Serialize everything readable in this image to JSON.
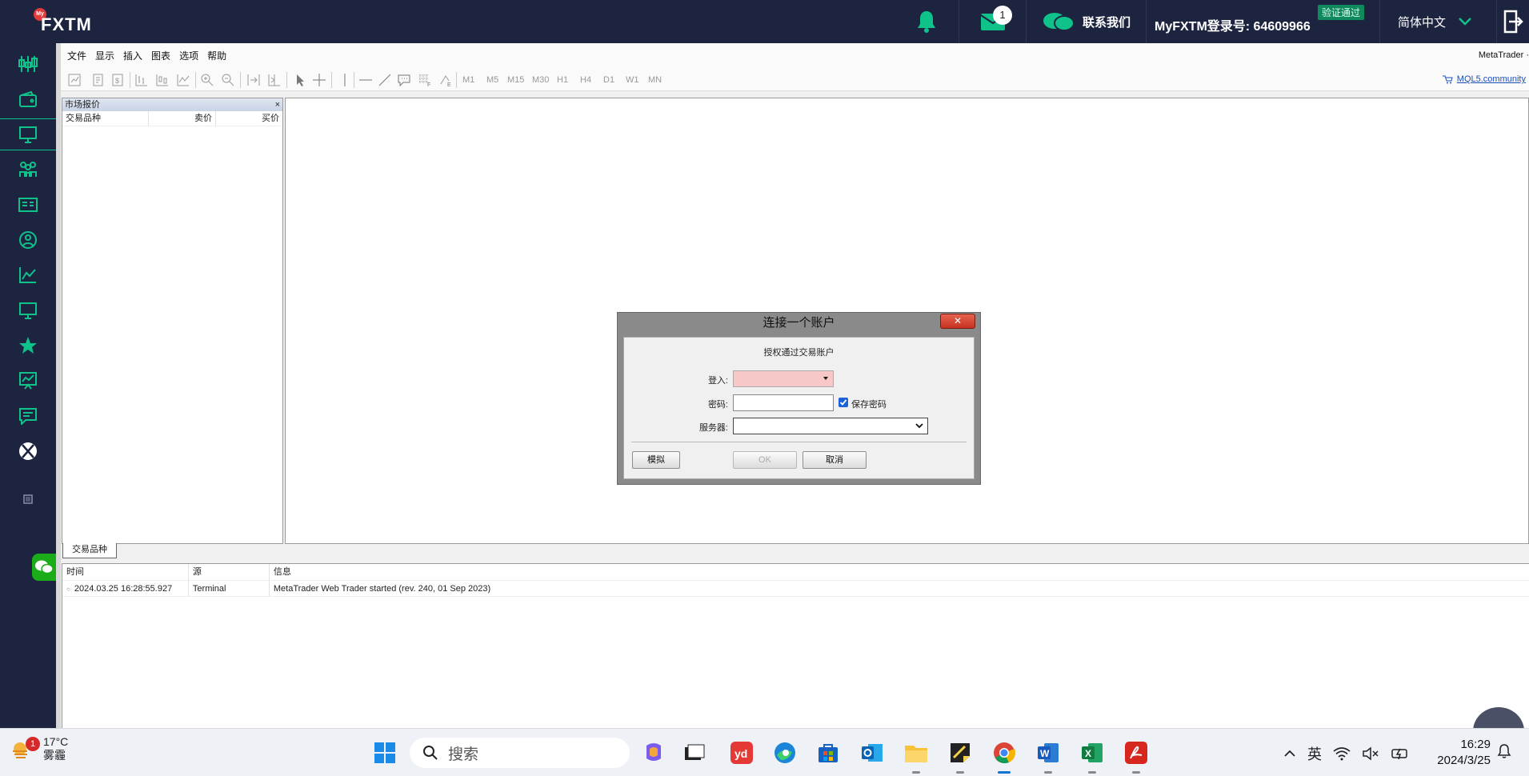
{
  "topbar": {
    "logo_badge": "My",
    "logo_text": "FXTM",
    "mail_count": "1",
    "contact_label": "联系我们",
    "account_label": "MyFXTM登录号: 64609966",
    "verified_label": "验证通过",
    "language": "简体中文"
  },
  "rail": {
    "items": [
      "trading-icon",
      "wallet-icon",
      "monitor-icon",
      "partners-icon",
      "news-icon",
      "profile-icon",
      "chart-icon",
      "desktop-icon",
      "star-icon",
      "analytics-icon",
      "chat-icon",
      "ball-icon"
    ]
  },
  "mt": {
    "menu": [
      "文件",
      "显示",
      "插入",
      "图表",
      "选项",
      "帮助"
    ],
    "title": "MetaTrader ·",
    "timeframes": [
      "M1",
      "M5",
      "M15",
      "M30",
      "H1",
      "H4",
      "D1",
      "W1",
      "MN"
    ],
    "mql5_link": "MQL5.community"
  },
  "market_watch": {
    "title": "市场报价",
    "close": "×",
    "columns": [
      "交易品种",
      "卖价",
      "买价"
    ],
    "tab": "交易品种"
  },
  "journal": {
    "columns": [
      "时间",
      "源",
      "信息"
    ],
    "rows": [
      {
        "time": "2024.03.25 16:28:55.927",
        "source": "Terminal",
        "message": "MetaTrader Web Trader started (rev. 240, 01 Sep 2023)"
      }
    ]
  },
  "dialog": {
    "title": "连接一个账户",
    "close": "✕",
    "subtitle": "授权通过交易账户",
    "login_label": "登入:",
    "login_value": "",
    "password_label": "密码:",
    "password_value": "",
    "save_password_label": "保存密码",
    "save_password_checked": true,
    "server_label": "服务器:",
    "server_value": "",
    "demo_button": "模拟",
    "ok_button": "OK",
    "cancel_button": "取消"
  },
  "taskbar": {
    "weather_badge": "1",
    "temperature": "17°C",
    "weather_desc": "雾霾",
    "search_placeholder": "搜索",
    "apps": [
      "start-icon",
      "copilot-icon",
      "desktop-icon",
      "youdao-icon",
      "edge-icon",
      "store-icon",
      "outlook-icon",
      "explorer-icon",
      "sticky-icon",
      "chrome-icon",
      "word-icon",
      "excel-icon",
      "acrobat-icon"
    ],
    "ime": "英",
    "time": "16:29",
    "date": "2024/3/25"
  },
  "colors": {
    "brand_navy": "#1d2440",
    "accent_green": "#0fc28a",
    "verified_bg": "#0f8a5c"
  }
}
